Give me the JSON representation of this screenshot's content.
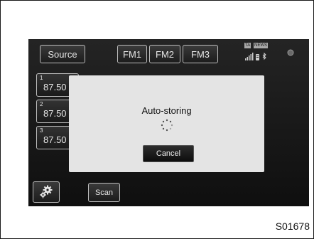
{
  "source_label": "Source",
  "bands": [
    "FM1",
    "FM2",
    "FM3"
  ],
  "status": {
    "ta": "TA",
    "news": "NEWS"
  },
  "presets": [
    {
      "number": "1",
      "frequency": "87.50"
    },
    {
      "number": "2",
      "frequency": "87.50"
    },
    {
      "number": "3",
      "frequency": "87.50"
    }
  ],
  "dialog": {
    "title": "Auto-storing",
    "cancel_label": "Cancel"
  },
  "bottom": {
    "scan_label": "Scan",
    "settings_icon": "gear-icon"
  },
  "figure_id": "S01678",
  "colors": {
    "screen": "#1a1a1a",
    "dialog": "#e4e4e4",
    "button_border": "#bdbdbd"
  }
}
